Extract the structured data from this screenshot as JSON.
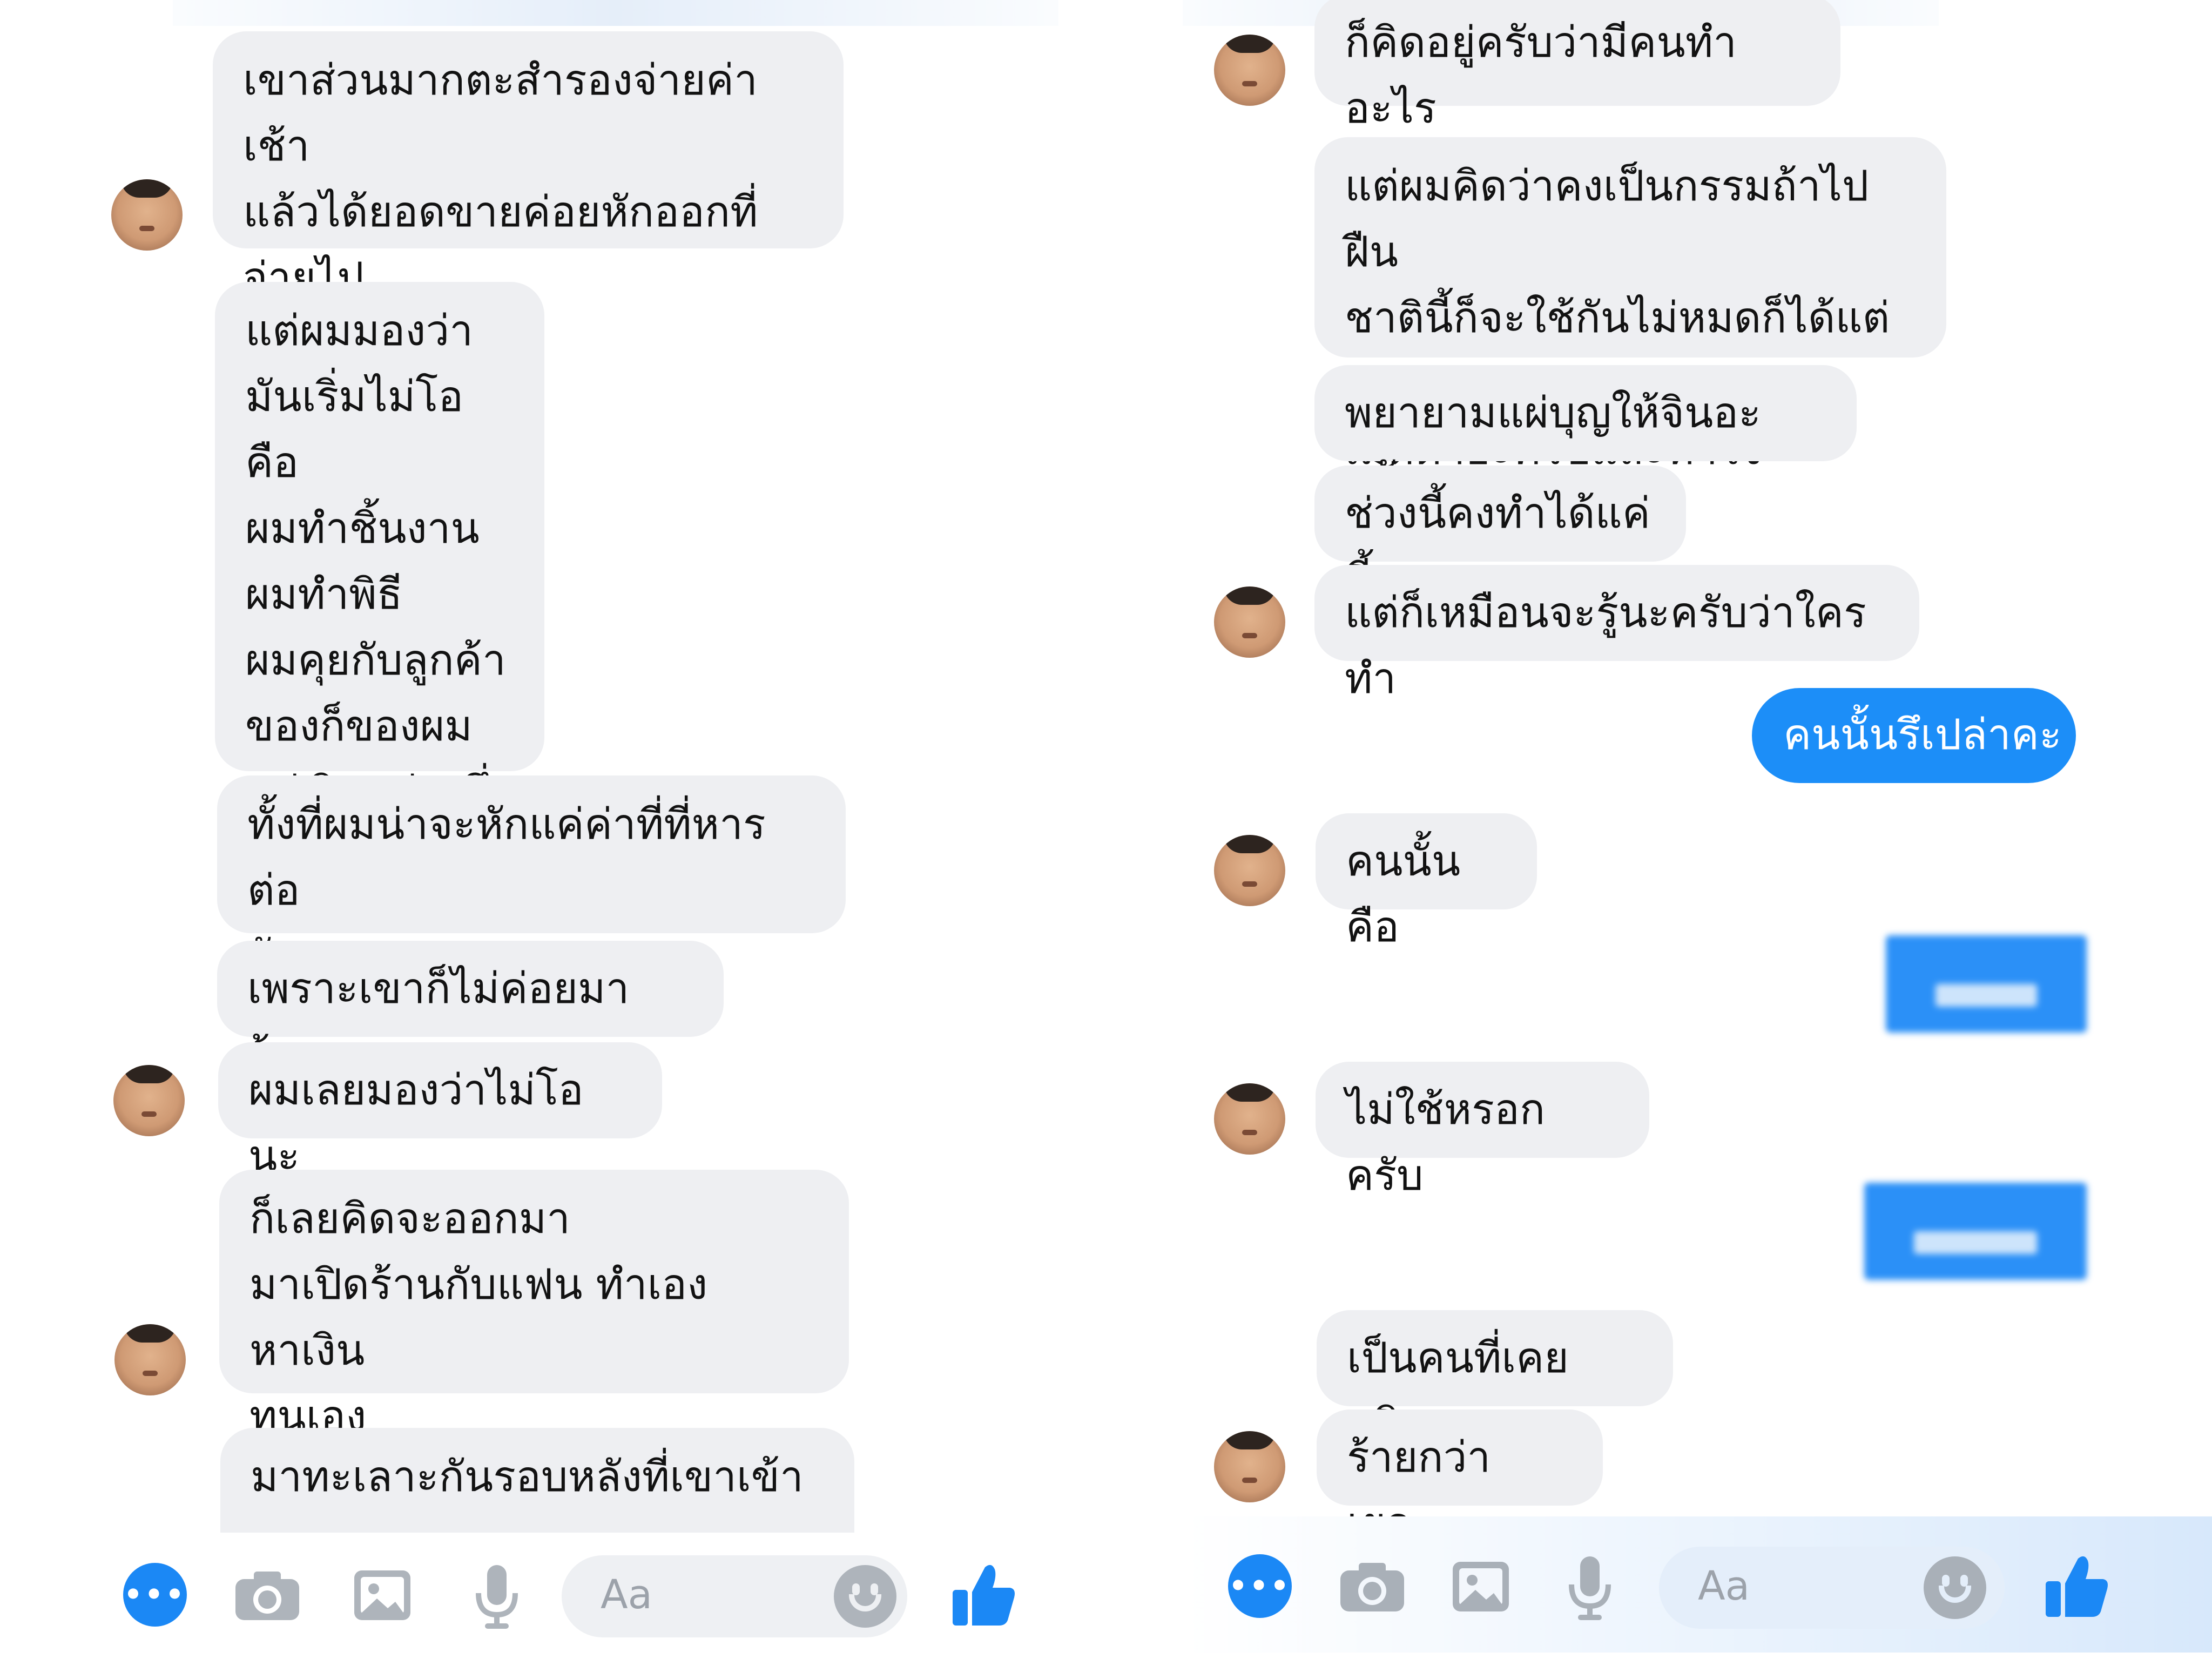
{
  "left_chat": {
    "messages": [
      {
        "text": "เขาส่วนมากตะสำรองจ่ายค่าเช้า\nแล้วได้ยอดขายค่อยหักออกที่\nจ่ายไป"
      },
      {
        "text": "แต่ผมมองว่า\nมันเริ่มไม่โอคือ\nผมทำชิ้นงาน\nผมทำพิธี\nผมคุยกับลูกค้า\nของก็ของผม\nแต่เงินแบ่งครึ่ง"
      },
      {
        "text": "ทั้งที่ผมน่าจะหักแค่ค่าที่ที่หารต่อ\nวัน"
      },
      {
        "text": "เพราะเขาก็ไม่ค่อยมาร้าน"
      },
      {
        "text": "ผมเลยมองว่าไม่โอนะ"
      },
      {
        "text": "ก็เลยคิดจะออกมา\nมาเปิดร้านกับแฟน ทำเองหาเงิน\nทุนเอง"
      },
      {
        "text": "มาทะเลาะกันรอบหลังที่เขาเข้า"
      }
    ],
    "composer_placeholder": "Aa"
  },
  "right_chat": {
    "messages": [
      {
        "type": "in",
        "text": "ก็คิดอยู่ครับว่ามีคนทำอะไร"
      },
      {
        "type": "in",
        "text": "แต่ผมคิดว่าคงเป็นกรรมถ้าไปฝืน\nชาตินี้ก็จะใช้กันไม่หมดก็ได้แต่แผ่\nเมตตาอะครับและทำใจ"
      },
      {
        "type": "in",
        "text": "พยายามแผ่บุญให้จินอะครับ"
      },
      {
        "type": "in",
        "text": "ช่วงนี้คงทำได้แค่นี้"
      },
      {
        "type": "in",
        "text": "แต่ก็เหมือนจะรู้นะครับว่าใครทำ"
      },
      {
        "type": "out",
        "text": "คนนั้นรึเปล่าคะ"
      },
      {
        "type": "in",
        "text": "คนนั้นคือ"
      },
      {
        "type": "in",
        "text": "ไม่ใช้หรอกครับ"
      },
      {
        "type": "in",
        "text": "เป็นคนที่เคยสนิท"
      },
      {
        "type": "in",
        "text": "ร้ายกว่าเยอะ"
      }
    ],
    "composer_placeholder": "Aa"
  },
  "colors": {
    "incoming_bubble": "#eeeff2",
    "outgoing_bubble": "#1c8ef8",
    "accent": "#1b88f5"
  },
  "icons": [
    "more-icon",
    "camera-icon",
    "image-icon",
    "microphone-icon",
    "emoji-icon",
    "thumbs-up-icon"
  ]
}
